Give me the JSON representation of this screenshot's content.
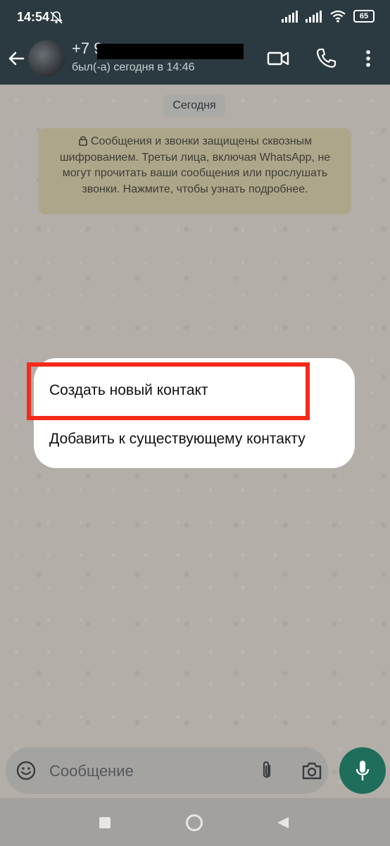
{
  "status_bar": {
    "time": "14:54",
    "battery": "65",
    "icons": [
      "mute-bell-icon",
      "signal-icon",
      "signal-icon",
      "wifi-icon",
      "battery-icon"
    ]
  },
  "header": {
    "contact_name": "+7 9",
    "last_seen": "был(-а) сегодня в 14:46",
    "icons": [
      "back-arrow-icon",
      "video-call-icon",
      "phone-call-icon",
      "more-vert-icon"
    ]
  },
  "chat": {
    "date_chip": "Сегодня",
    "encryption_notice": "Сообщения и звонки защищены сквозным шифрованием. Третьи лица, включая WhatsApp, не могут прочитать ваши сообщения или прослушать звонки. Нажмите, чтобы узнать подробнее."
  },
  "context_menu": {
    "items": [
      {
        "label": "Создать новый контакт"
      },
      {
        "label": "Добавить к существующему контакту"
      }
    ]
  },
  "composer": {
    "placeholder": "Сообщение",
    "icons": [
      "emoji-icon",
      "attach-icon",
      "camera-icon",
      "mic-icon"
    ]
  },
  "colors": {
    "header_bg": "#2b3a40",
    "accent_green": "#1e6e5b",
    "highlight_red": "#f52a1b"
  }
}
